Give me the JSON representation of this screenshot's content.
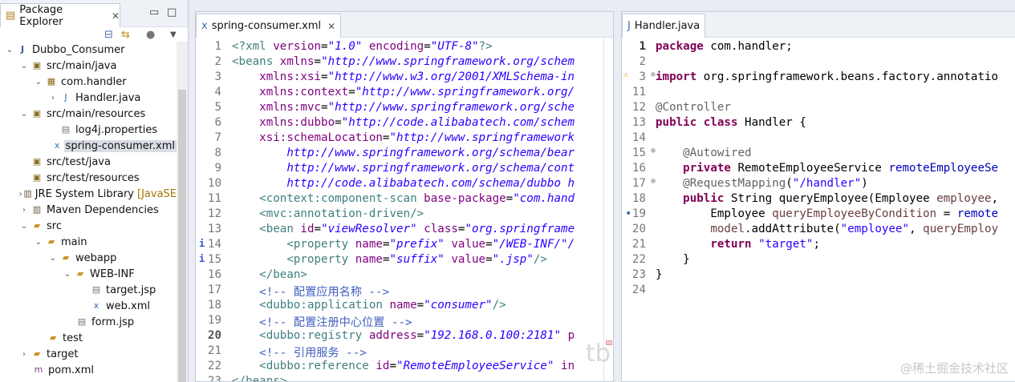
{
  "explorer": {
    "title": "Package Explorer",
    "items": [
      {
        "label": "Dubbo_Consumer",
        "extra": ""
      },
      {
        "label": "src/main/java",
        "extra": ""
      },
      {
        "label": "com.handler",
        "extra": ""
      },
      {
        "label": "Handler.java",
        "extra": ""
      },
      {
        "label": "src/main/resources",
        "extra": ""
      },
      {
        "label": "log4j.properties",
        "extra": ""
      },
      {
        "label": "spring-consumer.xml",
        "extra": ""
      },
      {
        "label": "src/test/java",
        "extra": ""
      },
      {
        "label": "src/test/resources",
        "extra": ""
      },
      {
        "label": "JRE System Library",
        "extra": "[JavaSE"
      },
      {
        "label": "Maven Dependencies",
        "extra": ""
      },
      {
        "label": "src",
        "extra": ""
      },
      {
        "label": "main",
        "extra": ""
      },
      {
        "label": "webapp",
        "extra": ""
      },
      {
        "label": "WEB-INF",
        "extra": ""
      },
      {
        "label": "target.jsp",
        "extra": ""
      },
      {
        "label": "web.xml",
        "extra": ""
      },
      {
        "label": "form.jsp",
        "extra": ""
      },
      {
        "label": "test",
        "extra": ""
      },
      {
        "label": "target",
        "extra": ""
      },
      {
        "label": "pom.xml",
        "extra": ""
      }
    ]
  },
  "xml_editor": {
    "tab": "spring-consumer.xml",
    "line_numbers": [
      "1",
      "2",
      "3",
      "4",
      "5",
      "6",
      "7",
      "8",
      "9",
      "10",
      "11",
      "12",
      "13",
      "14",
      "15",
      "16",
      "17",
      "18",
      "19",
      "20",
      "21",
      "22",
      "23"
    ]
  },
  "java_editor": {
    "tab": "Handler.java",
    "line_numbers": [
      "1",
      "2",
      "3",
      "11",
      "12",
      "13",
      "14",
      "15",
      "16",
      "17",
      "18",
      "19",
      "20",
      "21",
      "22",
      "23",
      "24"
    ]
  },
  "watermark": "@稀土掘金技术社区",
  "watermark_bg": "tb"
}
